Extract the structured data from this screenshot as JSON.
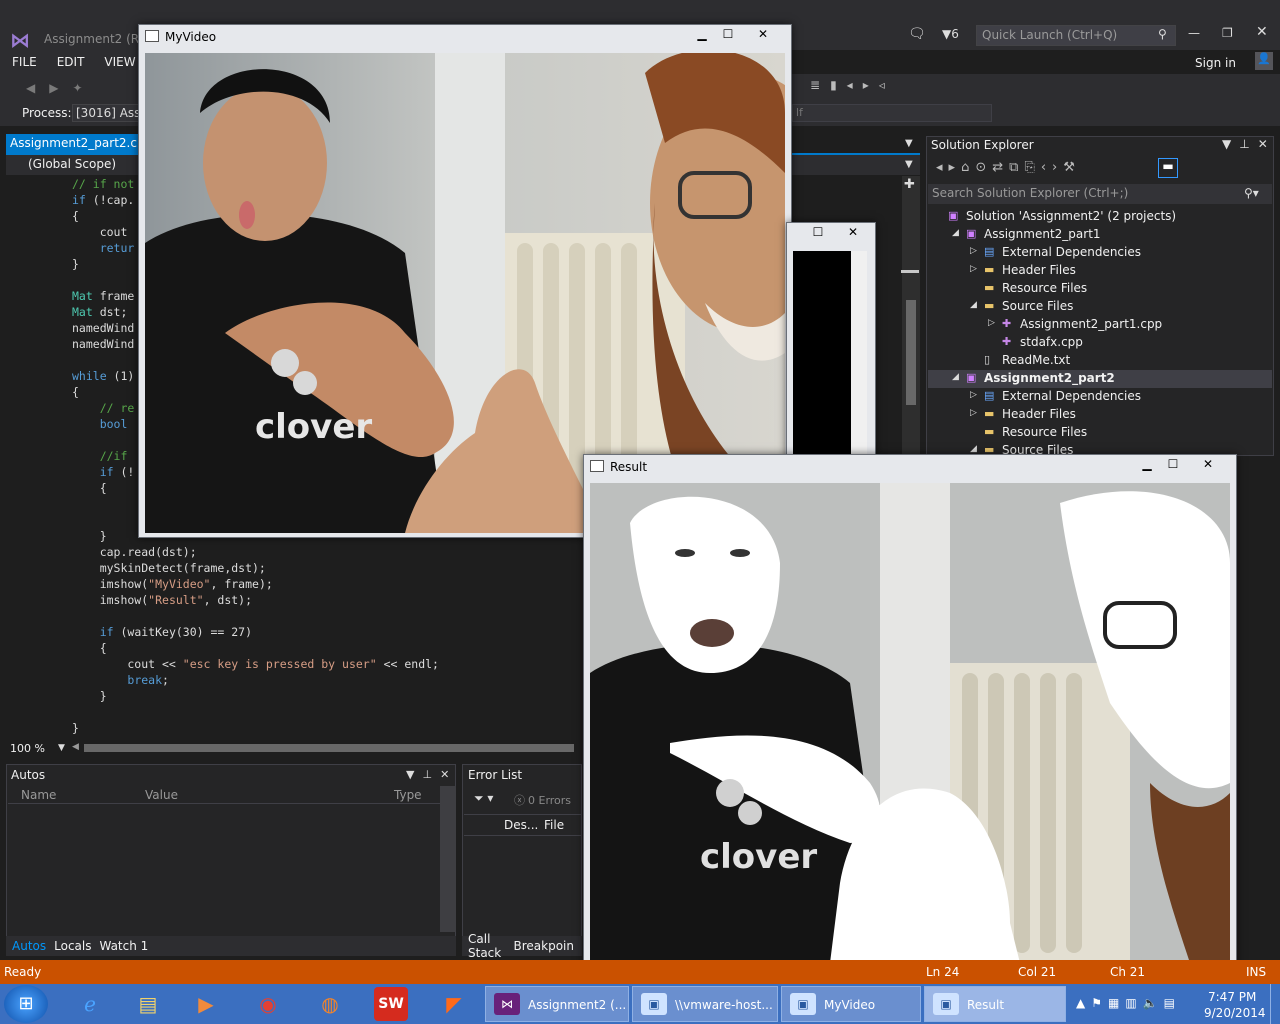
{
  "vs": {
    "title": "Assignment2 (Ru",
    "notifications_count": "6",
    "quick_launch_placeholder": "Quick Launch (Ctrl+Q)",
    "sign_in": "Sign in",
    "menu": [
      "FILE",
      "EDIT",
      "VIEW"
    ],
    "process_label": "Process:",
    "process_value": "[3016] Assig",
    "status_combo": "lf",
    "doc_tab": "Assignment2_part2.cpp",
    "scope": "(Global Scope)",
    "zoom": "100 %",
    "code_lines": [
      "// if not",
      "if (!cap.",
      "{",
      "    cout",
      "    retur",
      "}",
      "",
      "Mat frame",
      "Mat dst;",
      "namedWind",
      "namedWind",
      "",
      "while (1)",
      "{",
      "    // re",
      "    bool",
      "",
      "    //if",
      "    if (!",
      "    {",
      "",
      "",
      "    }",
      "    cap.read(dst);",
      "    mySkinDetect(frame,dst);",
      "    imshow(\"MyVideo\", frame);",
      "    imshow(\"Result\", dst);",
      "",
      "    if (waitKey(30) == 27)",
      "    {",
      "        cout << \"esc key is pressed by user\" << endl;",
      "        break;",
      "    }",
      "",
      "}"
    ]
  },
  "autos": {
    "title": "Autos",
    "columns": [
      "Name",
      "Value",
      "Type"
    ],
    "tabs": [
      "Autos",
      "Locals",
      "Watch 1"
    ]
  },
  "error_list": {
    "title": "Error List",
    "errors": "0 Errors",
    "columns": [
      "Des...",
      "File"
    ],
    "tabs": [
      "Call Stack",
      "Breakpoin"
    ]
  },
  "solution_explorer": {
    "title": "Solution Explorer",
    "search_placeholder": "Search Solution Explorer (Ctrl+;)",
    "items": [
      {
        "label": "Solution 'Assignment2' (2 projects)",
        "indent": 0,
        "expander": "",
        "icon": "solution-icon"
      },
      {
        "label": "Assignment2_part1",
        "indent": 1,
        "expander": "◢",
        "icon": "project-icon"
      },
      {
        "label": "External Dependencies",
        "indent": 2,
        "expander": "▷",
        "icon": "dependencies-icon"
      },
      {
        "label": "Header Files",
        "indent": 2,
        "expander": "▷",
        "icon": "folder-icon"
      },
      {
        "label": "Resource Files",
        "indent": 2,
        "expander": "",
        "icon": "folder-icon"
      },
      {
        "label": "Source Files",
        "indent": 2,
        "expander": "◢",
        "icon": "folder-icon"
      },
      {
        "label": "Assignment2_part1.cpp",
        "indent": 3,
        "expander": "▷",
        "icon": "cpp-file-icon"
      },
      {
        "label": "stdafx.cpp",
        "indent": 3,
        "expander": "",
        "icon": "cpp-file-icon"
      },
      {
        "label": "ReadMe.txt",
        "indent": 2,
        "expander": "",
        "icon": "text-file-icon"
      },
      {
        "label": "Assignment2_part2",
        "indent": 1,
        "expander": "◢",
        "icon": "project-icon",
        "bold": true
      },
      {
        "label": "External Dependencies",
        "indent": 2,
        "expander": "▷",
        "icon": "dependencies-icon"
      },
      {
        "label": "Header Files",
        "indent": 2,
        "expander": "▷",
        "icon": "folder-icon"
      },
      {
        "label": "Resource Files",
        "indent": 2,
        "expander": "",
        "icon": "folder-icon"
      },
      {
        "label": "Source Files",
        "indent": 2,
        "expander": "◢",
        "icon": "folder-icon"
      }
    ]
  },
  "windows": {
    "myvideo_title": "MyVideo",
    "result_title": "Result",
    "shirt_text": "clover"
  },
  "status": {
    "ready": "Ready",
    "ln": "Ln 24",
    "col": "Col 21",
    "ch": "Ch 21",
    "ins": "INS"
  },
  "taskbar": {
    "tasks": [
      "Assignment2 (...",
      "\\\\vmware-host...",
      "MyVideo",
      "Result"
    ],
    "time": "7:47 PM",
    "date": "9/20/2014"
  },
  "colors": {
    "accent": "#007acc",
    "statusbar": "#ca5100",
    "taskbar": "#3b6fc0"
  }
}
